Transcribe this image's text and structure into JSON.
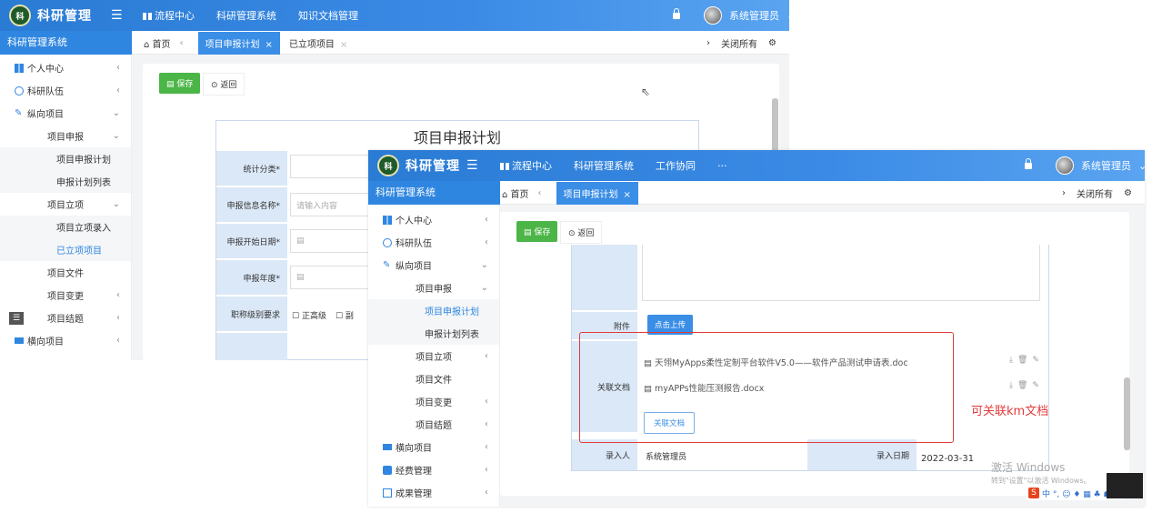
{
  "app": {
    "logo_text": "科",
    "brand": "科研管理",
    "system_title": "科研管理系统",
    "user": "系统管理员"
  },
  "back": {
    "topnav": [
      "流程中心",
      "科研管理系统",
      "知识文档管理"
    ],
    "tabs": {
      "home": "首页",
      "active": "项目申报计划",
      "other": "已立项项目",
      "close_all": "关闭所有"
    },
    "sidebar": [
      {
        "label": "个人中心"
      },
      {
        "label": "科研队伍"
      },
      {
        "label": "纵向项目"
      },
      {
        "label": "项目申报"
      },
      {
        "label": "项目申报计划"
      },
      {
        "label": "申报计划列表"
      },
      {
        "label": "项目立项"
      },
      {
        "label": "项目立项录入"
      },
      {
        "label": "已立项项目"
      },
      {
        "label": "项目文件"
      },
      {
        "label": "项目变更"
      },
      {
        "label": "项目结题"
      },
      {
        "label": "横向项目"
      }
    ],
    "buttons": {
      "save": "保存",
      "back": "返回"
    },
    "form": {
      "title": "项目申报计划",
      "fields": [
        {
          "label": "统计分类*",
          "value": ""
        },
        {
          "label": "申报信息名称*",
          "value": "请输入内容"
        },
        {
          "label": "申报开始日期*",
          "value": ""
        },
        {
          "label": "申报年度*",
          "value": ""
        },
        {
          "label": "职称级别要求",
          "value": ""
        }
      ],
      "options": [
        "正高级",
        "副"
      ]
    }
  },
  "front": {
    "topnav": [
      "流程中心",
      "科研管理系统",
      "工作协同",
      "···"
    ],
    "tabs": {
      "home": "首页",
      "active": "项目申报计划",
      "close_all": "关闭所有"
    },
    "sidebar": [
      {
        "label": "个人中心"
      },
      {
        "label": "科研队伍"
      },
      {
        "label": "纵向项目"
      },
      {
        "label": "项目申报"
      },
      {
        "label": "项目申报计划"
      },
      {
        "label": "申报计划列表"
      },
      {
        "label": "项目立项"
      },
      {
        "label": "项目文件"
      },
      {
        "label": "项目变更"
      },
      {
        "label": "项目结题"
      },
      {
        "label": "横向项目"
      },
      {
        "label": "经费管理"
      },
      {
        "label": "成果管理"
      }
    ],
    "buttons": {
      "save": "保存",
      "back": "返回"
    },
    "form": {
      "attachment_label": "附件",
      "upload_btn": "点击上传",
      "related_docs_label": "关联文档",
      "docs": [
        "天翎MyApps柔性定制平台软件V5.0——软件产品测试申请表.doc",
        "myAPPs性能压测报告.docx"
      ],
      "link_doc_btn": "关联文档",
      "entered_by_label": "录入人",
      "entered_by": "系统管理员",
      "entry_date_label": "录入日期",
      "entry_date": "2022-03-31"
    },
    "annotation": "可关联km文档"
  },
  "watermark": {
    "line1": "激活 Windows",
    "line2": "转到\"设置\"以激活 Windows。"
  },
  "ime": "中 °, ☺ ♦ ▦ ♣ ☗ ▦"
}
